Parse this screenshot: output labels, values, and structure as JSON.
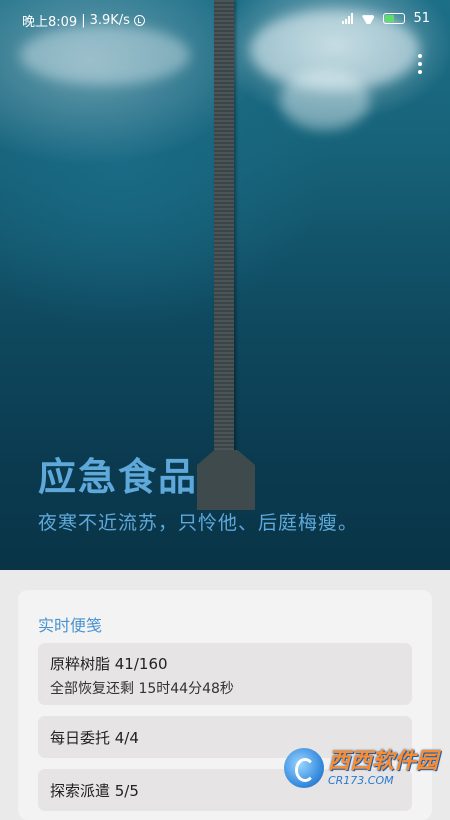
{
  "status_bar": {
    "time": "晚上8:09",
    "speed": "3.9K/s",
    "battery": "51",
    "battery_level": 0.51,
    "icons": [
      "clock-icon",
      "signal-icon",
      "wifi-icon",
      "battery-icon"
    ]
  },
  "hero": {
    "title": "应急食品",
    "quote": "夜寒不近流苏，只怜他、后庭梅瘦。",
    "menu_icon": "more-vert-icon"
  },
  "notes": {
    "title": "实时便笺",
    "items": [
      {
        "main": "原粹树脂 41/160",
        "sub": "全部恢复还剩 15时44分48秒"
      },
      {
        "main": "每日委托 4/4"
      },
      {
        "main": "探索派遣 5/5"
      }
    ]
  },
  "watermark": {
    "big": "西西软件园",
    "small": "CR173.COM"
  },
  "colors": {
    "accent": "#5fa8da",
    "panel_title": "#4a93cf",
    "card_bg": "#e6e4e4"
  }
}
